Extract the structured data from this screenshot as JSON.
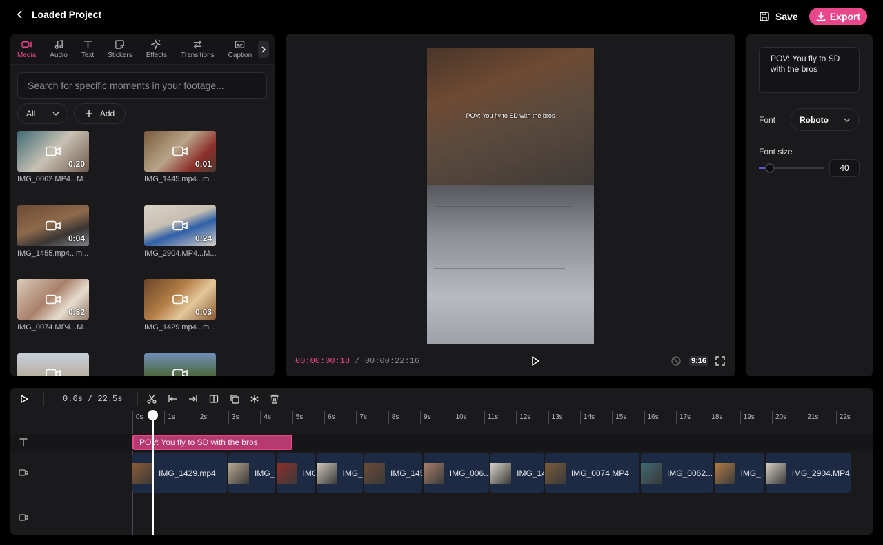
{
  "header": {
    "back_label": "Loaded Project",
    "save_label": "Save",
    "export_label": "Export"
  },
  "colors": {
    "accent": "#e8478b",
    "clip": "#1c2a44",
    "slider": "#5b5bd6"
  },
  "tabs": [
    {
      "label": "Media",
      "icon": "video-camera-icon",
      "active": true
    },
    {
      "label": "Audio",
      "icon": "music-note-icon"
    },
    {
      "label": "Text",
      "icon": "text-icon"
    },
    {
      "label": "Stickers",
      "icon": "sticker-icon"
    },
    {
      "label": "Effects",
      "icon": "sparkles-icon"
    },
    {
      "label": "Transitions",
      "icon": "transitions-icon"
    },
    {
      "label": "Caption",
      "icon": "caption-icon"
    }
  ],
  "search": {
    "placeholder": "Search for specific moments in your footage..."
  },
  "filter": {
    "selected": "All"
  },
  "add_label": "Add",
  "media": [
    {
      "name": "IMG_0062.MP4...M...",
      "duration": "0:20"
    },
    {
      "name": "IMG_1445.mp4...m...",
      "duration": "0:01"
    },
    {
      "name": "IMG_1455.mp4...m...",
      "duration": "0:04"
    },
    {
      "name": "IMG_2904.MP4...M...",
      "duration": "0:24"
    },
    {
      "name": "IMG_0074.MP4...M...",
      "duration": "0:32"
    },
    {
      "name": "IMG_1429.mp4...m...",
      "duration": "0:03"
    },
    {
      "name": "",
      "duration": ""
    },
    {
      "name": "",
      "duration": ""
    }
  ],
  "preview": {
    "overlay_text": "POV: You fly to SD with the bros",
    "current_time": "00:00:00:18",
    "separator": "/",
    "total_time": "00:00:22:16",
    "aspect_ratio": "9:16"
  },
  "properties": {
    "text_value": "POV: You fly to SD with the bros",
    "font_label": "Font",
    "font_value": "Roboto",
    "font_size_label": "Font size",
    "font_size_value": "40",
    "font_size_fraction": 0.17
  },
  "timeline": {
    "time_display": "0.6s / 22.5s",
    "ticks": [
      "0s",
      "1s",
      "2s",
      "3s",
      "4s",
      "5s",
      "6s",
      "7s",
      "8s",
      "9s",
      "10s",
      "11s",
      "12s",
      "13s",
      "14s",
      "15s",
      "16s",
      "17s",
      "18s",
      "19s",
      "20s",
      "21s",
      "22s"
    ],
    "text_clip": "POV: You fly to SD with the bros",
    "video_clips": [
      {
        "name": "IMG_1429.mp4",
        "start": 0,
        "end": 3
      },
      {
        "name": "IMG_...",
        "start": 3,
        "end": 4.5
      },
      {
        "name": "IMG...",
        "start": 4.5,
        "end": 5.75
      },
      {
        "name": "IMG_...",
        "start": 5.75,
        "end": 7.25
      },
      {
        "name": "IMG_145",
        "start": 7.25,
        "end": 9.1
      },
      {
        "name": "IMG_006...",
        "start": 9.1,
        "end": 11.2
      },
      {
        "name": "IMG_14...",
        "start": 11.2,
        "end": 12.9
      },
      {
        "name": "IMG_0074.MP4",
        "start": 12.9,
        "end": 15.9
      },
      {
        "name": "IMG_0062....",
        "start": 15.9,
        "end": 18.2
      },
      {
        "name": "IMG_...",
        "start": 18.2,
        "end": 19.8
      },
      {
        "name": "IMG_2904.MP4",
        "start": 19.8,
        "end": 22.5
      }
    ]
  }
}
